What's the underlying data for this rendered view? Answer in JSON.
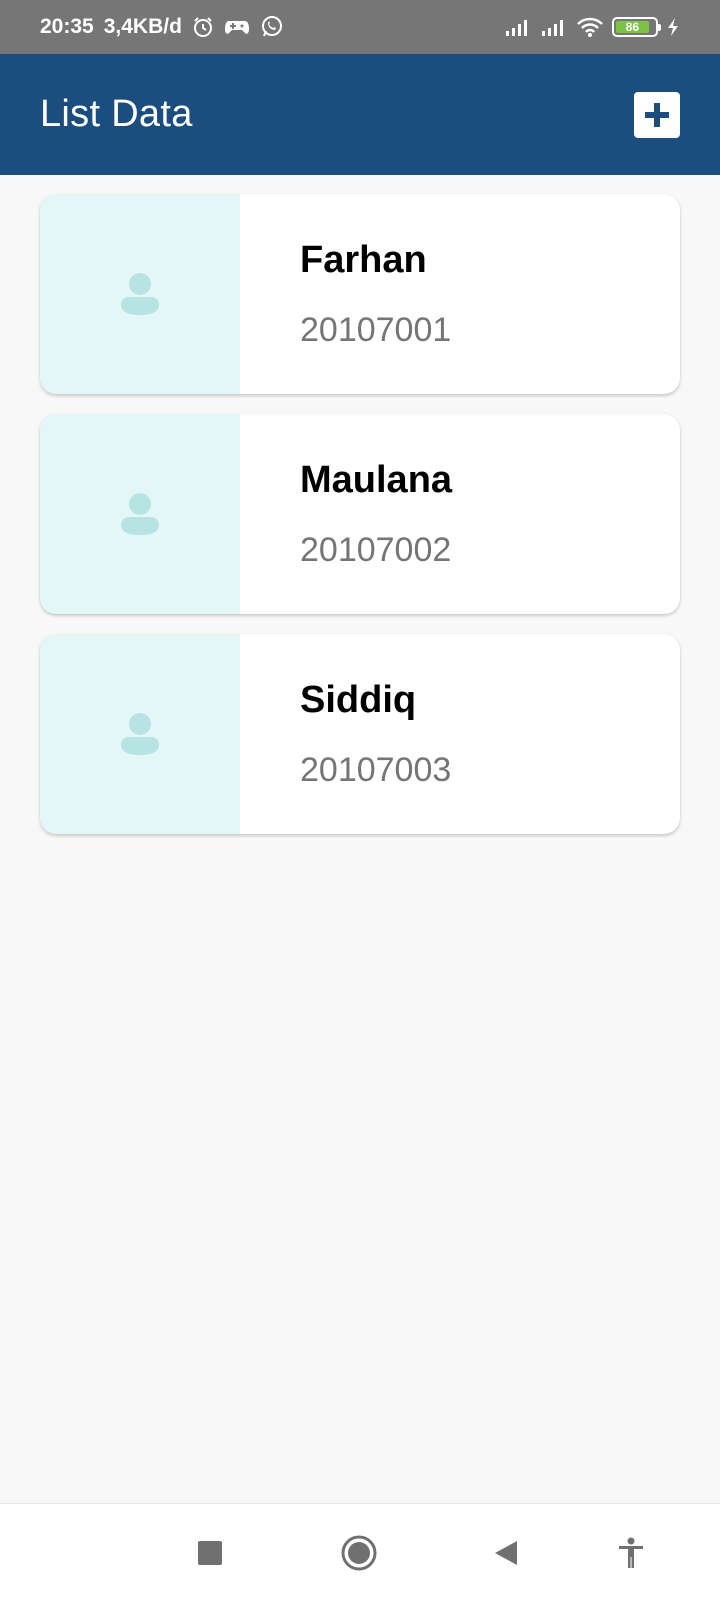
{
  "status_bar": {
    "time": "20:35",
    "network_speed": "3,4KB/d",
    "battery_level": "86",
    "icons": [
      "alarm-icon",
      "game-controller-icon",
      "whatsapp-icon",
      "signal-icon",
      "signal-icon",
      "wifi-icon",
      "battery-icon",
      "charging-icon"
    ]
  },
  "app_bar": {
    "title": "List Data",
    "add_icon": "plus-icon"
  },
  "list": {
    "items": [
      {
        "name": "Farhan",
        "id": "20107001",
        "avatar_icon": "person-icon"
      },
      {
        "name": "Maulana",
        "id": "20107002",
        "avatar_icon": "person-icon"
      },
      {
        "name": "Siddiq",
        "id": "20107003",
        "avatar_icon": "person-icon"
      }
    ]
  },
  "nav_bar": {
    "icons": [
      "recents-icon",
      "home-icon",
      "back-icon",
      "accessibility-icon"
    ]
  },
  "colors": {
    "app_bar": "#1b4d7e",
    "status_bar": "#767676",
    "thumb_bg": "#e3f7f7",
    "avatar": "#b8e3e3",
    "id_text": "#757575"
  }
}
